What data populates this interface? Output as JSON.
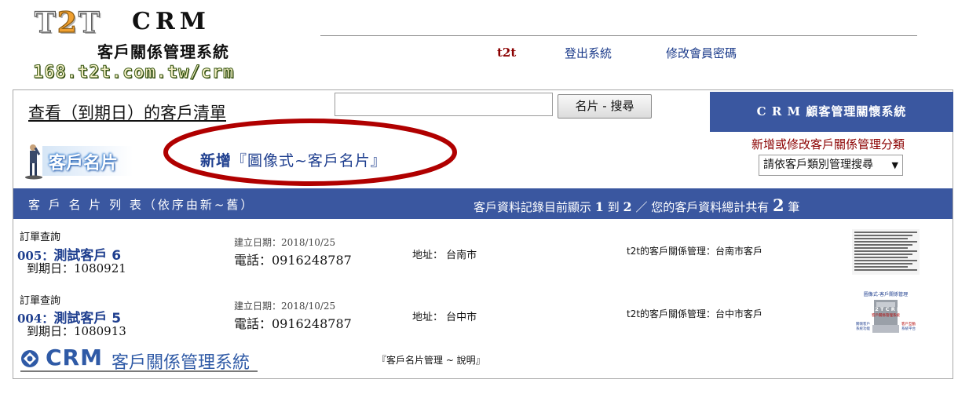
{
  "header": {
    "logo_t2t_left": "T",
    "logo_t2t_mid": "2",
    "logo_t2t_right": "T",
    "logo_crm": "CRM",
    "logo_subtitle": "客戶關係管理系統",
    "logo_url": "168.t2t.com.tw/crm",
    "username": "t2t",
    "logout_label": "登出系統",
    "change_password_label": "修改會員密碼"
  },
  "toolbar": {
    "list_title": "查看（到期日）的客戶清單",
    "search_value": "",
    "search_button": "名片 - 搜尋",
    "crm_banner": "C R M 顧客管理關懷系統"
  },
  "section": {
    "card_logo_text": "客戶名片",
    "add_card_prefix": "新增",
    "add_card_rest": "『圖像式~客戶名片』",
    "category_label": "新增或修改客戶關係管理分類",
    "category_select_value": "請依客戶類別管理搜尋",
    "list_bar_left": "客 戶 名 片 列 表（依序由新~舊）",
    "list_bar_right_a": "客戶資料記錄目前顯示",
    "list_bar_from": "1",
    "list_bar_to_word": "到",
    "list_bar_to": "2",
    "list_bar_right_b": "／ 您的客戶資料總計共有",
    "list_bar_total": "2",
    "list_bar_unit": "筆"
  },
  "rows": [
    {
      "order_query": "訂單查詢",
      "code": "005：",
      "name": "測試客戶 6",
      "expiry": "到期日：1080921",
      "created": "建立日期：2018/10/25",
      "phone": "電話：0916248787",
      "address": "地址： 台南市",
      "category": "t2t的客戶關係管理：台南市客戶"
    },
    {
      "order_query": "訂單查詢",
      "code": "004：",
      "name": "測試客戶 5",
      "expiry": "到期日：1080913",
      "created": "建立日期：2018/10/25",
      "phone": "電話：0916248787",
      "address": "地址： 台中市",
      "category": "t2t的客戶關係管理：台中市客戶"
    }
  ],
  "thumb2": {
    "title": "圖像式-客戶關係管理",
    "center": "T 2 T C R M",
    "sub": "客戶關係管理系統",
    "left_a": "關懷客戶",
    "left_b": "系統功能",
    "right_a": "客戶互動",
    "right_b": "系統平台"
  },
  "footer": {
    "crm": "CRM",
    "system": "客戶關係管理系統",
    "help_link": "『客戶名片管理 ~ 說明』"
  },
  "colors": {
    "banner_blue": "#3a57a0",
    "link_blue": "#1f3f8f",
    "dark_red": "#8b0000",
    "ellipse_red": "#b00000"
  }
}
